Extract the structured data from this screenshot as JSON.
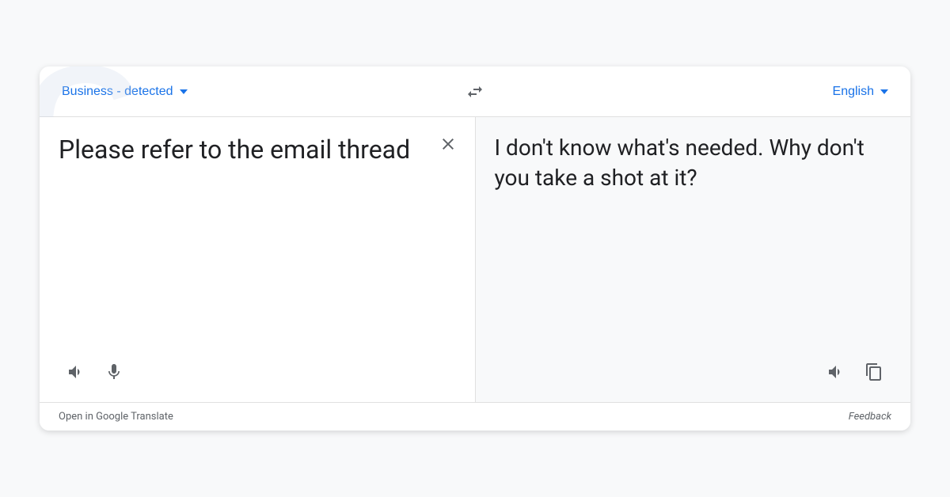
{
  "header": {
    "source_lang": "Business - detected",
    "target_lang": "English",
    "swap_label": "Swap languages"
  },
  "source_panel": {
    "input_text": "Please refer to the email thread",
    "close_label": "Clear input"
  },
  "target_panel": {
    "output_text": "I don't know what's needed. Why don't you take a shot at it?"
  },
  "footer": {
    "open_link": "Open in Google Translate",
    "feedback_link": "Feedback"
  },
  "icons": {
    "volume": "volume-icon",
    "mic": "mic-icon",
    "copy": "copy-icon",
    "swap": "swap-icon",
    "close": "close-icon"
  }
}
